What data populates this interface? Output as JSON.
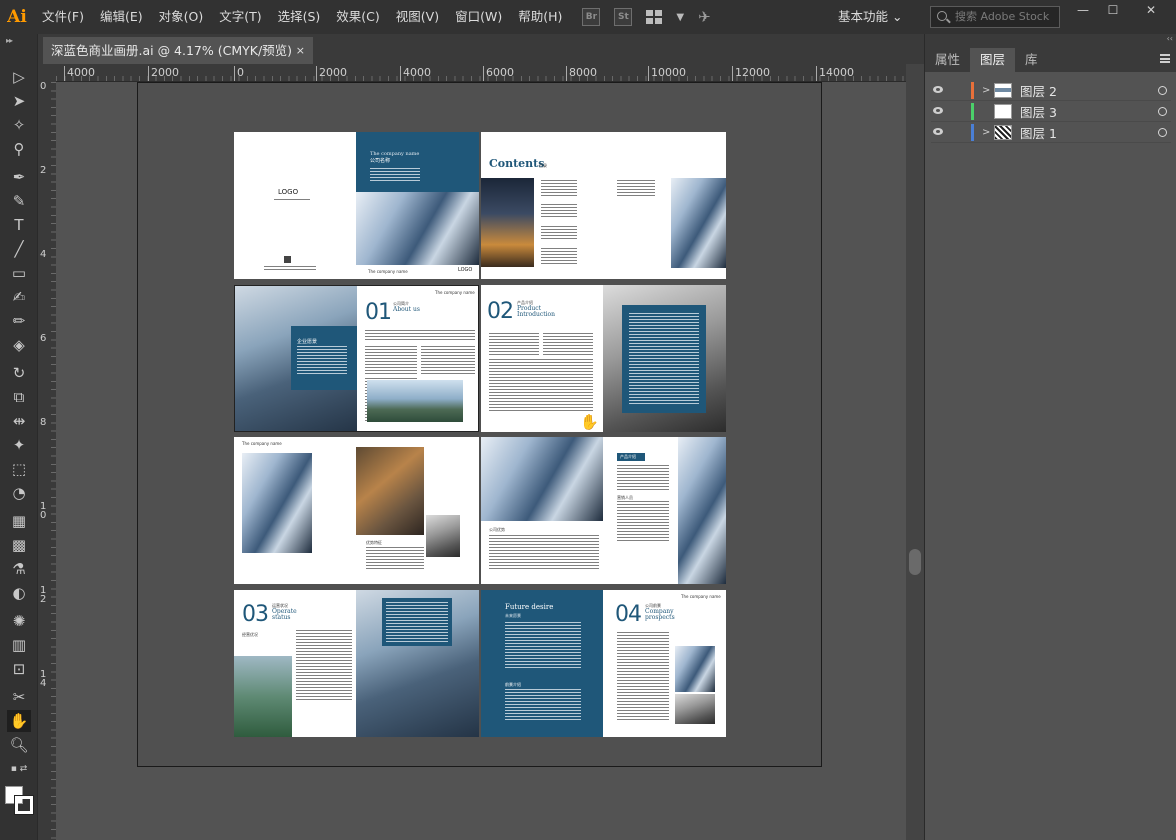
{
  "app": {
    "logo": "Ai"
  },
  "menu": [
    "文件(F)",
    "编辑(E)",
    "对象(O)",
    "文字(T)",
    "选择(S)",
    "效果(C)",
    "视图(V)",
    "窗口(W)",
    "帮助(H)"
  ],
  "app_icons": {
    "bridge": "Br",
    "stock": "St"
  },
  "workspace": "基本功能 ⌄",
  "search": {
    "placeholder": "搜索 Adobe Stock"
  },
  "window_controls": {
    "minimize": "—",
    "maximize": "☐",
    "close": "✕"
  },
  "document_tab": {
    "title": "深蓝色商业画册.ai @ 4.17% (CMYK/预览)",
    "close": "×"
  },
  "ruler_h": [
    "4000",
    "2000",
    "0",
    "2000",
    "4000",
    "6000",
    "8000",
    "10000",
    "12000",
    "14000"
  ],
  "ruler_v": [
    "0",
    "2",
    "4",
    "6",
    "8",
    "1 0",
    "1 2",
    "1 4"
  ],
  "panel": {
    "tabs": [
      "属性",
      "图层",
      "库"
    ],
    "active_tab": "图层",
    "collapse": "‹‹"
  },
  "layers": [
    {
      "name": "图层 2",
      "color": "#e8703a",
      "expandable": true
    },
    {
      "name": "图层 3",
      "color": "#4bd06a",
      "expandable": false
    },
    {
      "name": "图层 1",
      "color": "#4a7fd6",
      "expandable": true
    }
  ],
  "artwork": {
    "cover": {
      "logo": "LOGO",
      "company_en": "The company name",
      "company_cn": "公司名称",
      "logo_bottom": "LOGO"
    },
    "contents": {
      "title": "Contents",
      "subtitle": "目录"
    },
    "p01": {
      "num": "01",
      "cn": "公司简介",
      "en": "About us",
      "box_title": "企业愿景"
    },
    "p02": {
      "num": "02",
      "cn": "产品介绍",
      "en1": "Product",
      "en2": "Introduction"
    },
    "p03": {
      "num": "03",
      "cn": "运营状况",
      "en1": "Operate",
      "en2": "status",
      "sub": "经营优况"
    },
    "future": {
      "en": "Future desire",
      "cn": "未来愿景",
      "sub": "前景介绍"
    },
    "p04": {
      "num": "04",
      "cn": "公司前景",
      "en1": "Company",
      "en2": "prospects"
    },
    "spread3": {
      "tag1": "产品介绍",
      "tag2": "营销人员",
      "tag3": "公司优势",
      "tag4": "优势特征"
    },
    "header_small": "The company name"
  }
}
